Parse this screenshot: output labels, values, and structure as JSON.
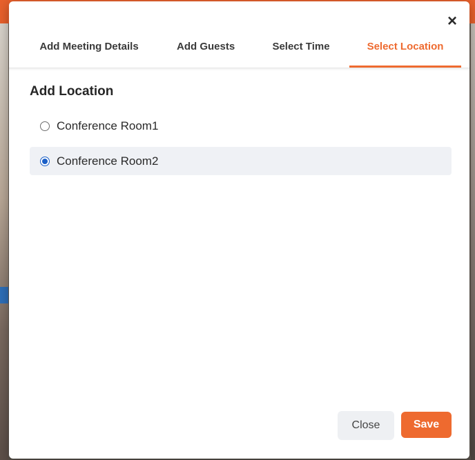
{
  "modal": {
    "close_icon": "×",
    "tabs": [
      {
        "label": "Add Meeting Details",
        "active": false
      },
      {
        "label": "Add Guests",
        "active": false
      },
      {
        "label": "Select Time",
        "active": false
      },
      {
        "label": "Select Location",
        "active": true
      }
    ],
    "section_title": "Add Location",
    "locations": [
      {
        "label": "Conference Room1",
        "selected": false
      },
      {
        "label": "Conference Room2",
        "selected": true
      }
    ],
    "buttons": {
      "close_label": "Close",
      "save_label": "Save"
    },
    "accent_color": "#ee6a2f",
    "radio_color": "#1a5fc7"
  }
}
